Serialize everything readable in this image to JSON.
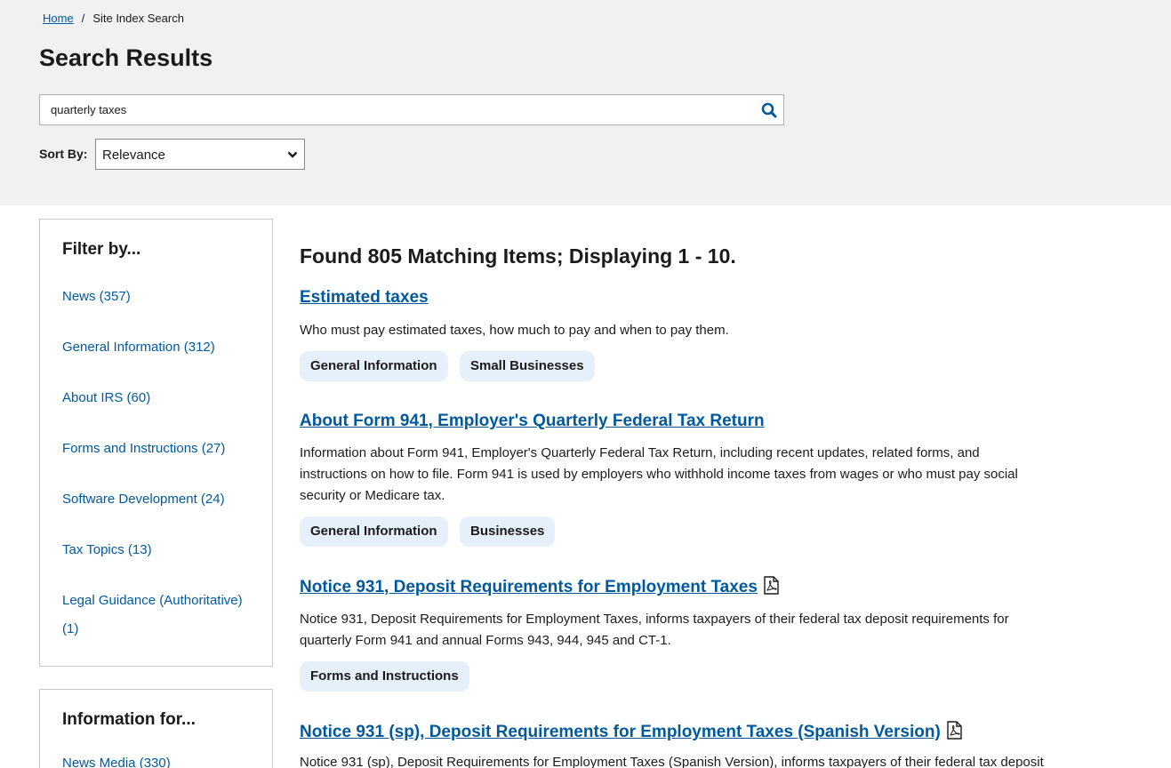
{
  "breadcrumb": {
    "home": "Home",
    "separator": "/",
    "current": "Site Index Search"
  },
  "page_title": "Search Results",
  "search": {
    "value": "quarterly taxes",
    "placeholder": "",
    "icon": "search-icon"
  },
  "sort": {
    "label": "Sort By:",
    "selected": "Relevance"
  },
  "filter": {
    "title": "Filter by...",
    "items": [
      {
        "label": "News (357)"
      },
      {
        "label": "General Information (312)"
      },
      {
        "label": "About IRS (60)"
      },
      {
        "label": "Forms and Instructions (27)"
      },
      {
        "label": "Software Development (24)"
      },
      {
        "label": "Tax Topics (13)"
      },
      {
        "label": "Legal Guidance (Authoritative) (1)"
      }
    ]
  },
  "info_for": {
    "title": "Information for...",
    "items": [
      {
        "label": "News Media (330)"
      }
    ]
  },
  "results_summary": "Found 805 Matching Items; Displaying 1 - 10.",
  "results": [
    {
      "title": "Estimated taxes",
      "pdf": false,
      "description": "Who must pay estimated taxes, how much to pay and when to pay them.",
      "tags": [
        "General Information",
        "Small Businesses"
      ]
    },
    {
      "title": "About Form 941, Employer's Quarterly Federal Tax Return",
      "pdf": false,
      "description": "Information about Form 941, Employer's Quarterly Federal Tax Return, including recent updates, related forms, and instructions on how to file. Form 941 is used by employers who withhold income taxes from wages or who must pay social security or Medicare tax.",
      "tags": [
        "General Information",
        "Businesses"
      ]
    },
    {
      "title": "Notice 931, Deposit Requirements for Employment Taxes",
      "pdf": true,
      "description": "Notice 931, Deposit Requirements for Employment Taxes, informs taxpayers of their federal tax deposit requirements for quarterly Form 941 and annual Forms 943, 944, 945 and CT-1.",
      "tags": [
        "Forms and Instructions"
      ]
    },
    {
      "title": "Notice 931 (sp), Deposit Requirements for Employment Taxes (Spanish Version)",
      "pdf": true,
      "description": "Notice 931 (sp), Deposit Requirements for Employment Taxes (Spanish Version), informs taxpayers of their federal tax deposit",
      "tags": []
    }
  ],
  "colors": {
    "link": "#00599c",
    "band": "#f1f1f1",
    "tag_bg": "#e6f0fa",
    "text": "#1b1b1b"
  }
}
